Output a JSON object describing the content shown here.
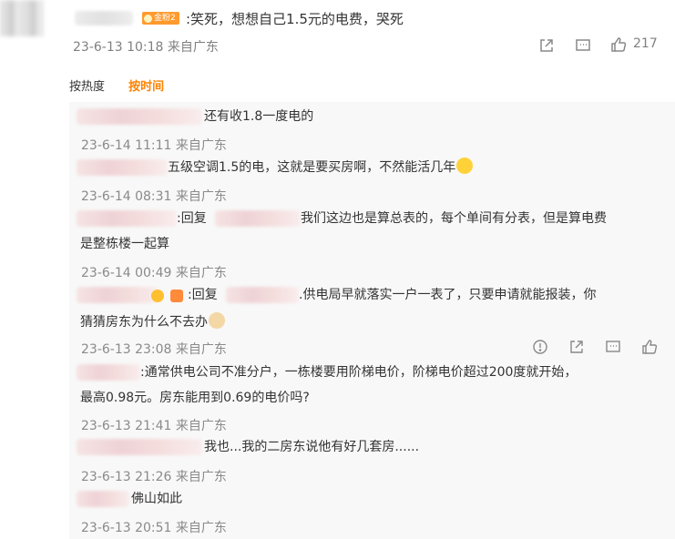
{
  "main_comment": {
    "badge": "金粉2",
    "text": ":笑死，想想自己1.5元的电费，哭死",
    "meta": "23-6-13 10:18 来自广东",
    "like_count": "217"
  },
  "sort": {
    "hot": "按热度",
    "time": "按时间"
  },
  "replies": [
    {
      "text": "还有收1.8一度电的",
      "meta": "23-6-14 11:11 来自广东"
    },
    {
      "text": "五级空调1.5的电，这就是要买房啊，不然能活几年",
      "meta": "23-6-14 08:31 来自广东"
    },
    {
      "text_prefix": ":回复",
      "text_line1": "我们这边也是算总表的，每个单间有分表，但是算电费",
      "text_line2": "是整栋楼一起算",
      "meta": "23-6-14 00:49 来自广东"
    },
    {
      "text_prefix": ":回复",
      "text_line1": ".供电局早就落实一户一表了，只要申请就能报装，你",
      "text_line2": "猜猜房东为什么不去办",
      "meta": "23-6-13 23:08 来自广东"
    },
    {
      "text_line1": ":通常供电公司不准分户，一栋楼要用阶梯电价，阶梯电价超过200度就开始，",
      "text_line2": "最高0.98元。房东能用到0.69的电价吗?",
      "meta": "23-6-13 21:41 来自广东"
    },
    {
      "text": "我也...我的二房东说他有好几套房......",
      "meta": "23-6-13 21:26 来自广东"
    },
    {
      "text": "佛山如此",
      "meta": "23-6-13 20:51 来自广东"
    }
  ]
}
